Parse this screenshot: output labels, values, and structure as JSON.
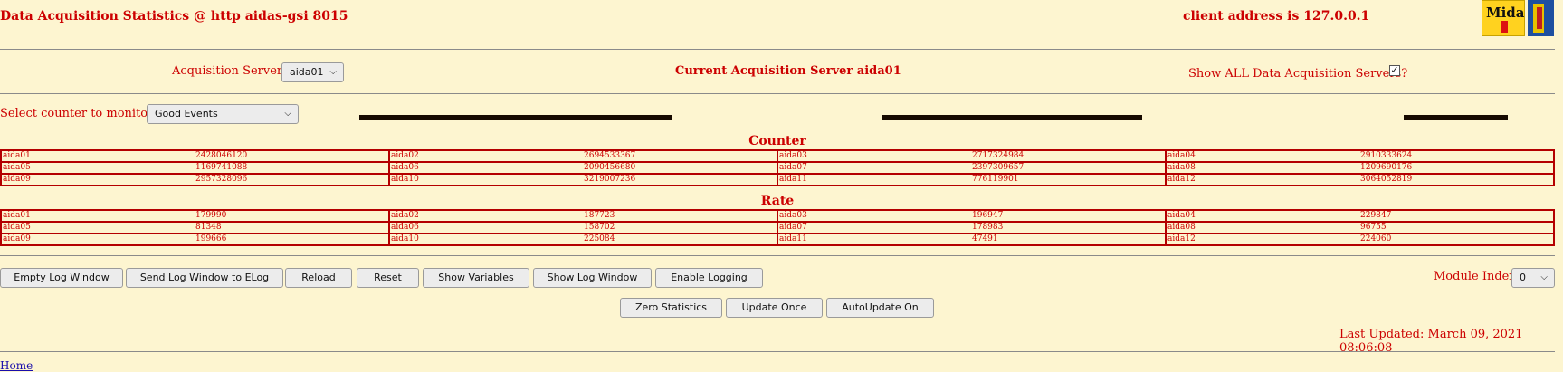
{
  "header": {
    "title": "Data Acquisition Statistics @ http aidas-gsi 8015",
    "client_address": "client address is 127.0.0.1",
    "logo_text": "Midas"
  },
  "servers": {
    "label": "Acquisition Servers",
    "selected": "aida01",
    "current": "Current Acquisition Server aida01",
    "show_all_label": "Show ALL Data Acquisition Servers?",
    "show_all_checked": true
  },
  "counter_select": {
    "label": "Select counter to monitor",
    "selected": "Good Events"
  },
  "counter": {
    "title": "Counter",
    "rows": [
      [
        [
          "aida01",
          "2428046120"
        ],
        [
          "aida02",
          "2694533367"
        ],
        [
          "aida03",
          "2717324984"
        ],
        [
          "aida04",
          "2910333624"
        ]
      ],
      [
        [
          "aida05",
          "1169741088"
        ],
        [
          "aida06",
          "2090456680"
        ],
        [
          "aida07",
          "2397309657"
        ],
        [
          "aida08",
          "1209690176"
        ]
      ],
      [
        [
          "aida09",
          "2957328096"
        ],
        [
          "aida10",
          "3219007236"
        ],
        [
          "aida11",
          "776119901"
        ],
        [
          "aida12",
          "3064052819"
        ]
      ]
    ]
  },
  "rate": {
    "title": "Rate",
    "rows": [
      [
        [
          "aida01",
          "179990"
        ],
        [
          "aida02",
          "187723"
        ],
        [
          "aida03",
          "196947"
        ],
        [
          "aida04",
          "229847"
        ]
      ],
      [
        [
          "aida05",
          "81348"
        ],
        [
          "aida06",
          "158702"
        ],
        [
          "aida07",
          "178983"
        ],
        [
          "aida08",
          "96755"
        ]
      ],
      [
        [
          "aida09",
          "199666"
        ],
        [
          "aida10",
          "225084"
        ],
        [
          "aida11",
          "47491"
        ],
        [
          "aida12",
          "224060"
        ]
      ]
    ]
  },
  "buttons": {
    "empty_log": "Empty Log Window",
    "send_log": "Send Log Window to ELog",
    "reload": "Reload",
    "reset": "Reset",
    "show_variables": "Show Variables",
    "show_log": "Show Log Window",
    "enable_logging": "Enable Logging",
    "zero_stats": "Zero Statistics",
    "update_once": "Update Once",
    "autoupdate": "AutoUpdate On"
  },
  "module_index": {
    "label": "Module Index",
    "value": "0"
  },
  "last_updated": "Last Updated: March 09, 2021 08:06:08",
  "footer": {
    "home_link": "Home"
  },
  "colors": {
    "background": "#fdf5d0",
    "text_red": "#cc0000",
    "border_red": "#b40000",
    "bar_black": "#160a00"
  }
}
